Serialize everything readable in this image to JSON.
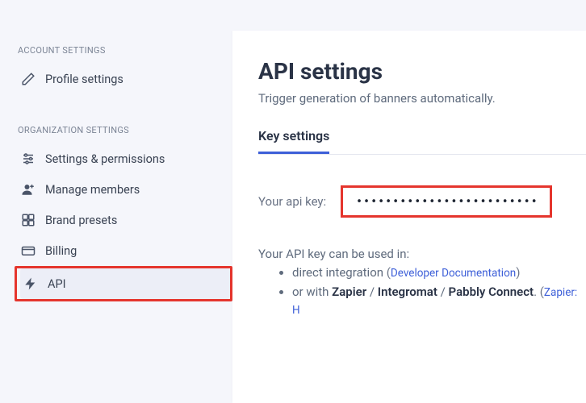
{
  "sidebar": {
    "section1_label": "ACCOUNT SETTINGS",
    "items1": [
      {
        "label": "Profile settings"
      }
    ],
    "section2_label": "ORGANIZATION SETTINGS",
    "items2": [
      {
        "label": "Settings & permissions"
      },
      {
        "label": "Manage members"
      },
      {
        "label": "Brand presets"
      },
      {
        "label": "Billing"
      },
      {
        "label": "API"
      }
    ]
  },
  "main": {
    "title": "API settings",
    "subtitle": "Trigger generation of banners automatically.",
    "tab_label": "Key settings",
    "key_label": "Your api key:",
    "key_value": "••••••••••••••••••••••••••••••••••",
    "usage_title": "Your API key can be used in:",
    "usage": {
      "item1_prefix": "direct integration ",
      "item1_link": "Developer Documentation",
      "item2_prefix": "or with ",
      "item2_zapier": "Zapier",
      "item2_sep1": " / ",
      "item2_integromat": "Integromat",
      "item2_sep2": " / ",
      "item2_pabbly": "Pabbly Connect",
      "item2_period": ". ",
      "item2_link": "Zapier: H"
    }
  }
}
